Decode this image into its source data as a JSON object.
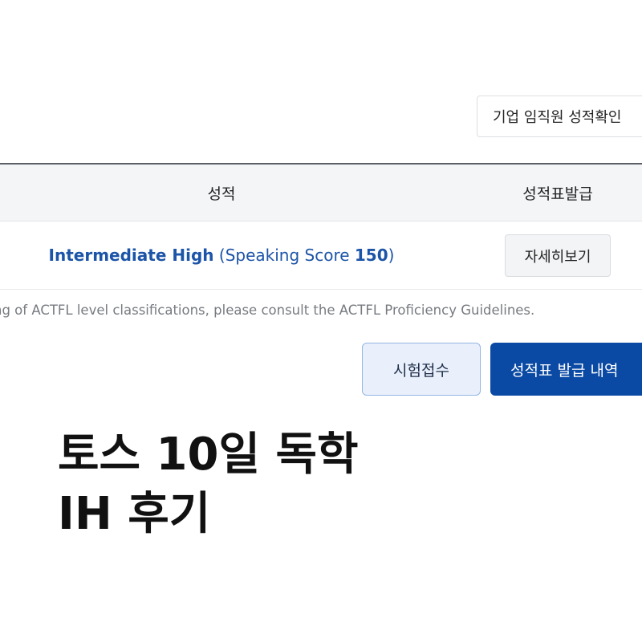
{
  "header": {
    "corporate_check_label": "기업 임직원 성적확인"
  },
  "table": {
    "headers": {
      "grade": "성적",
      "report": "성적표발급"
    },
    "row": {
      "level": "Intermediate High",
      "score_prefix": " (Speaking Score ",
      "score_value": "150",
      "score_suffix": ")",
      "detail_label": "자세히보기"
    }
  },
  "notice": {
    "text": "ng of ACTFL level classifications, please consult the ACTFL Proficiency Guidelines."
  },
  "actions": {
    "exam_register_label": "시험접수",
    "report_history_label": "성적표 발급 내역"
  },
  "overlay_title": {
    "line1": "토스 10일 독학",
    "line2": "IH 후기"
  },
  "colors": {
    "accent_blue": "#0b4aa4",
    "level_text_blue": "#1c54a8",
    "light_button_bg": "#e9f0fb"
  }
}
